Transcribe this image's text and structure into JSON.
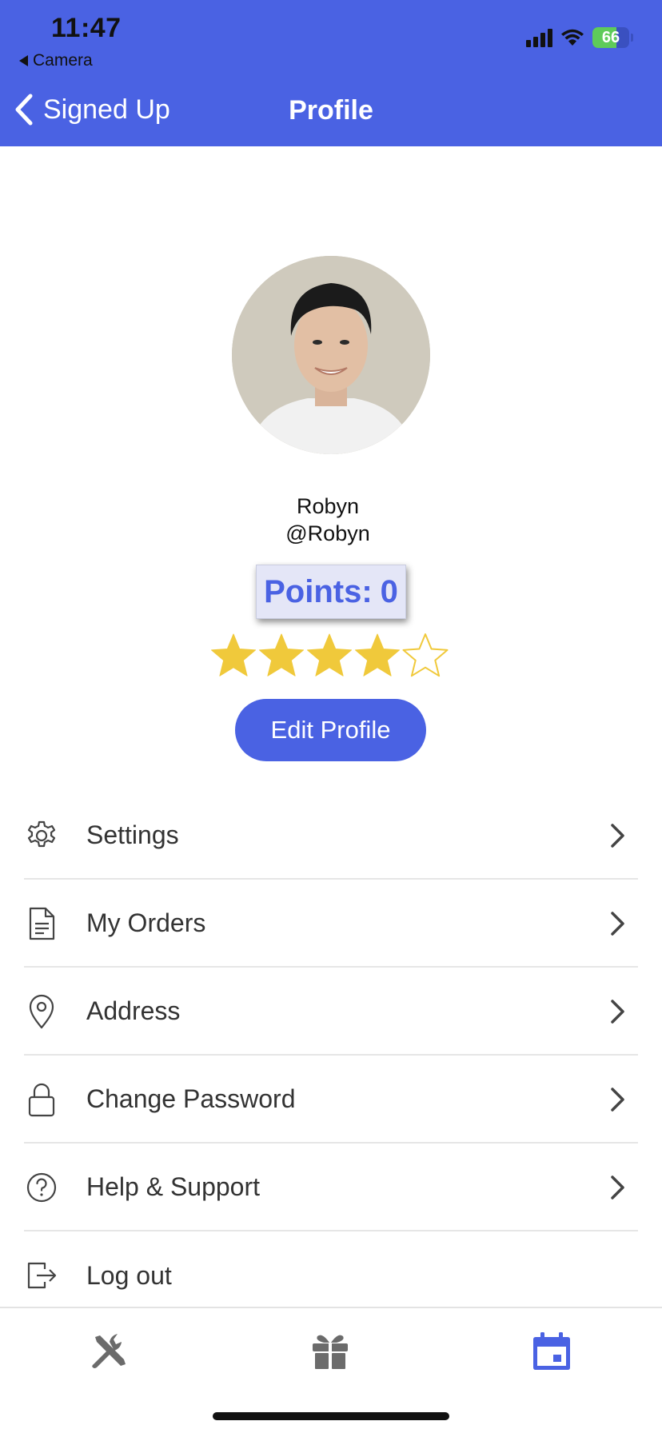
{
  "status_bar": {
    "time": "11:47",
    "back_app": "Camera",
    "battery_percent": "66"
  },
  "nav": {
    "back_label": "Signed Up",
    "title": "Profile"
  },
  "profile": {
    "display_name": "Robyn",
    "username": "@Robyn",
    "points_label": "Points:",
    "points_value": "0",
    "rating": 4,
    "rating_max": 5,
    "edit_button": "Edit Profile"
  },
  "menu": {
    "items": [
      {
        "label": "Settings",
        "icon": "gear-icon"
      },
      {
        "label": "My Orders",
        "icon": "document-icon"
      },
      {
        "label": "Address",
        "icon": "location-pin-icon"
      },
      {
        "label": "Change Password",
        "icon": "lock-icon"
      },
      {
        "label": "Help & Support",
        "icon": "help-circle-icon"
      },
      {
        "label": "Log out",
        "icon": "logout-icon"
      }
    ]
  },
  "tabbar": {
    "tabs": [
      {
        "icon": "tools-icon",
        "active": false
      },
      {
        "icon": "gift-icon",
        "active": false
      },
      {
        "icon": "calendar-icon",
        "active": true
      }
    ]
  },
  "colors": {
    "accent": "#4a62e3",
    "star": "#f0c93b",
    "points_bg": "#e4e6f7",
    "tab_inactive": "#6b6b6b"
  }
}
